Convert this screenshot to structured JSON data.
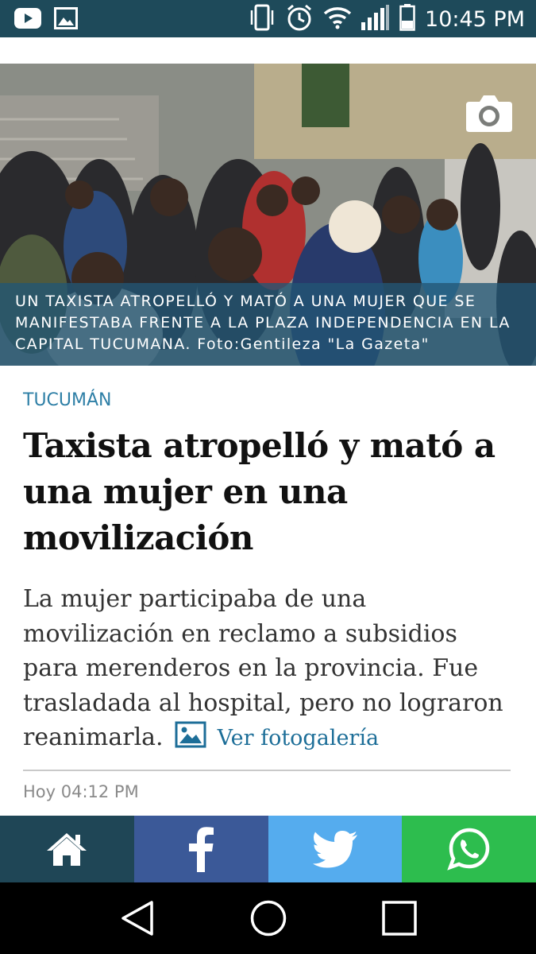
{
  "status_bar": {
    "time": "10:45 PM",
    "left_icons": [
      "youtube-icon",
      "gallery-icon"
    ],
    "right_icons": [
      "vibrate-icon",
      "alarm-icon",
      "wifi-icon",
      "signal-icon",
      "battery-icon"
    ]
  },
  "hero": {
    "caption": "UN TAXISTA ATROPELLÓ Y MATÓ A UNA MUJER QUE SE MANIFESTABA FRENTE A LA PLAZA INDEPENDENCIA EN LA CAPITAL TUCUMANA. Foto:Gentileza \"La Gazeta\"",
    "camera_icon": "camera-icon"
  },
  "article": {
    "section": "TUCUMÁN",
    "headline": "Taxista atropelló y mató a una mujer en una movilización",
    "summary": "La mujer participaba de una movilización en reclamo a subsidios para merenderos en la provincia. Fue trasladada al hospital, pero no lograron reanimarla.",
    "gallery_link": "Ver fotogalería",
    "timestamp": "Hoy 04:12 PM"
  },
  "share_bar": {
    "buttons": [
      {
        "icon": "home-icon",
        "color": "#1f4656"
      },
      {
        "icon": "facebook-icon",
        "color": "#3b5998"
      },
      {
        "icon": "twitter-icon",
        "color": "#55acee"
      },
      {
        "icon": "whatsapp-icon",
        "color": "#2dbd4e"
      }
    ]
  },
  "nav_bar": {
    "buttons": [
      "back-icon",
      "home-circle-icon",
      "recents-icon"
    ]
  },
  "colors": {
    "status_bar": "#1e4a5a",
    "section_label": "#2e7fa6",
    "link": "#1d6e98",
    "caption_band": "#225674"
  }
}
